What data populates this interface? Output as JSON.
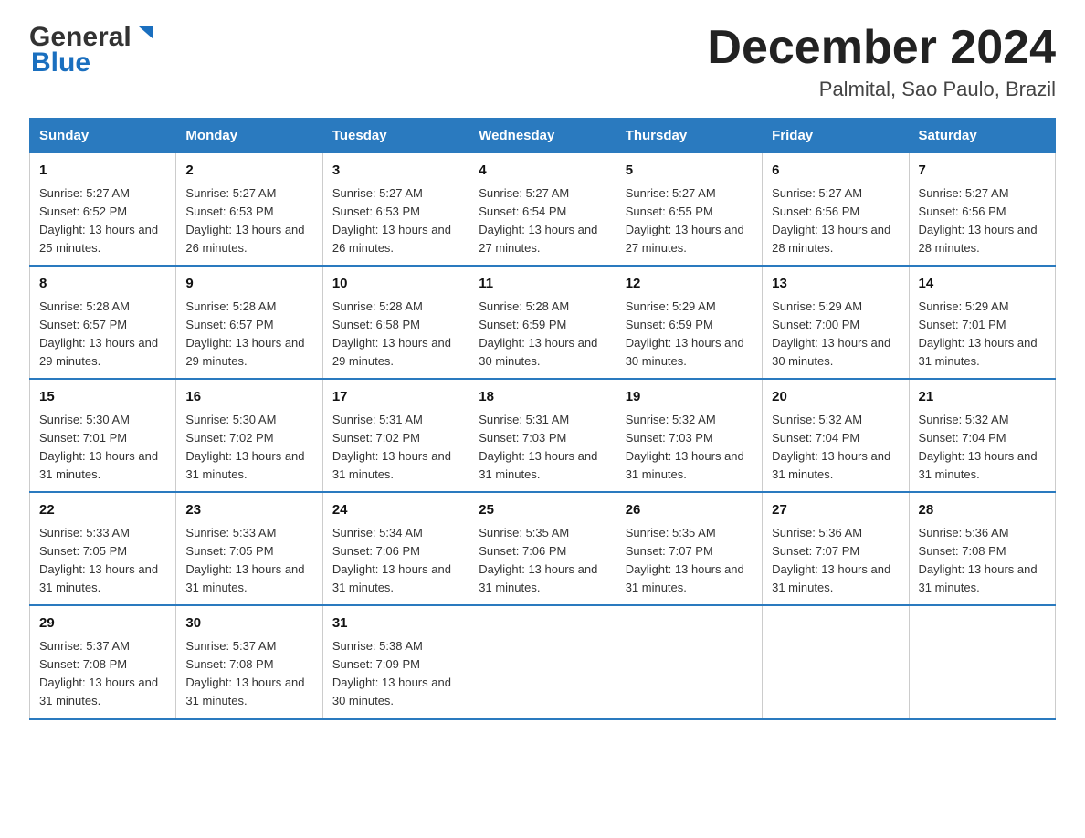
{
  "header": {
    "logo_general": "General",
    "logo_blue": "Blue",
    "month_title": "December 2024",
    "location": "Palmital, Sao Paulo, Brazil"
  },
  "days_of_week": [
    "Sunday",
    "Monday",
    "Tuesday",
    "Wednesday",
    "Thursday",
    "Friday",
    "Saturday"
  ],
  "weeks": [
    [
      {
        "day": "1",
        "sunrise": "5:27 AM",
        "sunset": "6:52 PM",
        "daylight": "13 hours and 25 minutes."
      },
      {
        "day": "2",
        "sunrise": "5:27 AM",
        "sunset": "6:53 PM",
        "daylight": "13 hours and 26 minutes."
      },
      {
        "day": "3",
        "sunrise": "5:27 AM",
        "sunset": "6:53 PM",
        "daylight": "13 hours and 26 minutes."
      },
      {
        "day": "4",
        "sunrise": "5:27 AM",
        "sunset": "6:54 PM",
        "daylight": "13 hours and 27 minutes."
      },
      {
        "day": "5",
        "sunrise": "5:27 AM",
        "sunset": "6:55 PM",
        "daylight": "13 hours and 27 minutes."
      },
      {
        "day": "6",
        "sunrise": "5:27 AM",
        "sunset": "6:56 PM",
        "daylight": "13 hours and 28 minutes."
      },
      {
        "day": "7",
        "sunrise": "5:27 AM",
        "sunset": "6:56 PM",
        "daylight": "13 hours and 28 minutes."
      }
    ],
    [
      {
        "day": "8",
        "sunrise": "5:28 AM",
        "sunset": "6:57 PM",
        "daylight": "13 hours and 29 minutes."
      },
      {
        "day": "9",
        "sunrise": "5:28 AM",
        "sunset": "6:57 PM",
        "daylight": "13 hours and 29 minutes."
      },
      {
        "day": "10",
        "sunrise": "5:28 AM",
        "sunset": "6:58 PM",
        "daylight": "13 hours and 29 minutes."
      },
      {
        "day": "11",
        "sunrise": "5:28 AM",
        "sunset": "6:59 PM",
        "daylight": "13 hours and 30 minutes."
      },
      {
        "day": "12",
        "sunrise": "5:29 AM",
        "sunset": "6:59 PM",
        "daylight": "13 hours and 30 minutes."
      },
      {
        "day": "13",
        "sunrise": "5:29 AM",
        "sunset": "7:00 PM",
        "daylight": "13 hours and 30 minutes."
      },
      {
        "day": "14",
        "sunrise": "5:29 AM",
        "sunset": "7:01 PM",
        "daylight": "13 hours and 31 minutes."
      }
    ],
    [
      {
        "day": "15",
        "sunrise": "5:30 AM",
        "sunset": "7:01 PM",
        "daylight": "13 hours and 31 minutes."
      },
      {
        "day": "16",
        "sunrise": "5:30 AM",
        "sunset": "7:02 PM",
        "daylight": "13 hours and 31 minutes."
      },
      {
        "day": "17",
        "sunrise": "5:31 AM",
        "sunset": "7:02 PM",
        "daylight": "13 hours and 31 minutes."
      },
      {
        "day": "18",
        "sunrise": "5:31 AM",
        "sunset": "7:03 PM",
        "daylight": "13 hours and 31 minutes."
      },
      {
        "day": "19",
        "sunrise": "5:32 AM",
        "sunset": "7:03 PM",
        "daylight": "13 hours and 31 minutes."
      },
      {
        "day": "20",
        "sunrise": "5:32 AM",
        "sunset": "7:04 PM",
        "daylight": "13 hours and 31 minutes."
      },
      {
        "day": "21",
        "sunrise": "5:32 AM",
        "sunset": "7:04 PM",
        "daylight": "13 hours and 31 minutes."
      }
    ],
    [
      {
        "day": "22",
        "sunrise": "5:33 AM",
        "sunset": "7:05 PM",
        "daylight": "13 hours and 31 minutes."
      },
      {
        "day": "23",
        "sunrise": "5:33 AM",
        "sunset": "7:05 PM",
        "daylight": "13 hours and 31 minutes."
      },
      {
        "day": "24",
        "sunrise": "5:34 AM",
        "sunset": "7:06 PM",
        "daylight": "13 hours and 31 minutes."
      },
      {
        "day": "25",
        "sunrise": "5:35 AM",
        "sunset": "7:06 PM",
        "daylight": "13 hours and 31 minutes."
      },
      {
        "day": "26",
        "sunrise": "5:35 AM",
        "sunset": "7:07 PM",
        "daylight": "13 hours and 31 minutes."
      },
      {
        "day": "27",
        "sunrise": "5:36 AM",
        "sunset": "7:07 PM",
        "daylight": "13 hours and 31 minutes."
      },
      {
        "day": "28",
        "sunrise": "5:36 AM",
        "sunset": "7:08 PM",
        "daylight": "13 hours and 31 minutes."
      }
    ],
    [
      {
        "day": "29",
        "sunrise": "5:37 AM",
        "sunset": "7:08 PM",
        "daylight": "13 hours and 31 minutes."
      },
      {
        "day": "30",
        "sunrise": "5:37 AM",
        "sunset": "7:08 PM",
        "daylight": "13 hours and 31 minutes."
      },
      {
        "day": "31",
        "sunrise": "5:38 AM",
        "sunset": "7:09 PM",
        "daylight": "13 hours and 30 minutes."
      },
      null,
      null,
      null,
      null
    ]
  ]
}
